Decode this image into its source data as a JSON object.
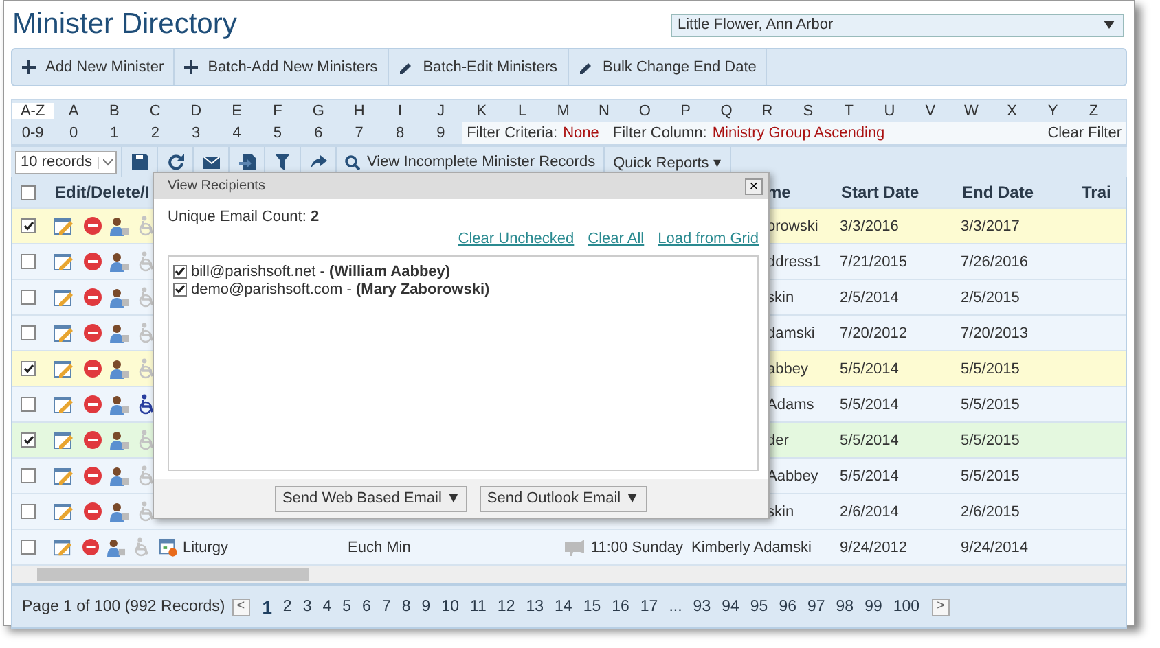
{
  "title": "Minister Directory",
  "parish": {
    "value": "Little Flower, Ann Arbor"
  },
  "toolbar": [
    {
      "label": "Add New Minister"
    },
    {
      "label": "Batch-Add New Ministers"
    },
    {
      "label": "Batch-Edit Ministers"
    },
    {
      "label": "Bulk Change End Date"
    }
  ],
  "letters": [
    {
      "label": "A-Z",
      "selected": true
    },
    {
      "label": "A",
      "selected": false
    },
    {
      "label": "B",
      "selected": false
    },
    {
      "label": "C",
      "selected": false
    },
    {
      "label": "D",
      "selected": false
    },
    {
      "label": "E",
      "selected": false
    },
    {
      "label": "F",
      "selected": false
    },
    {
      "label": "G",
      "selected": false
    },
    {
      "label": "H",
      "selected": false
    },
    {
      "label": "I",
      "selected": false
    },
    {
      "label": "J",
      "selected": false
    },
    {
      "label": "K",
      "selected": false
    },
    {
      "label": "L",
      "selected": false
    },
    {
      "label": "M",
      "selected": false
    },
    {
      "label": "N",
      "selected": false
    },
    {
      "label": "O",
      "selected": false
    },
    {
      "label": "P",
      "selected": false
    },
    {
      "label": "Q",
      "selected": false
    },
    {
      "label": "R",
      "selected": false
    },
    {
      "label": "S",
      "selected": false
    },
    {
      "label": "T",
      "selected": false
    },
    {
      "label": "U",
      "selected": false
    },
    {
      "label": "V",
      "selected": false
    },
    {
      "label": "W",
      "selected": false
    },
    {
      "label": "X",
      "selected": false
    },
    {
      "label": "Y",
      "selected": false
    },
    {
      "label": "Z",
      "selected": false
    }
  ],
  "digits": [
    {
      "label": "0-9",
      "selected": false
    },
    {
      "label": "0",
      "selected": false
    },
    {
      "label": "1",
      "selected": false
    },
    {
      "label": "2",
      "selected": false
    },
    {
      "label": "3",
      "selected": false
    },
    {
      "label": "4",
      "selected": false
    },
    {
      "label": "5",
      "selected": false
    },
    {
      "label": "6",
      "selected": false
    },
    {
      "label": "7",
      "selected": false
    },
    {
      "label": "8",
      "selected": false
    },
    {
      "label": "9",
      "selected": false
    }
  ],
  "filter": {
    "criteria_label": "Filter Criteria:",
    "criteria": "None",
    "column_label": "Filter Column:",
    "column": "Ministry Group Ascending",
    "clear": "Clear Filter"
  },
  "grid_toolbar": {
    "page_size": "10 records",
    "incomplete": "View Incomplete Minister Records",
    "reports": "Quick Reports ▾"
  },
  "select_all": {
    "checked": false
  },
  "columns": {
    "actions": "Edit/Delete/I",
    "name": "me",
    "start": "Start Date",
    "end": "End Date",
    "column_6": "Trai"
  },
  "rows": [
    {
      "kind": "partial",
      "checked": true,
      "color": "#fdfbd2",
      "accessible": false,
      "name": "orowski",
      "start": "3/3/2016",
      "end": "3/3/2017"
    },
    {
      "kind": "partial",
      "checked": false,
      "color": "#eef5fc",
      "accessible": false,
      "name": "ddress1",
      "start": "7/21/2015",
      "end": "7/26/2016"
    },
    {
      "kind": "partial",
      "checked": false,
      "color": "#eef5fc",
      "accessible": false,
      "name": "skin",
      "start": "2/5/2014",
      "end": "2/5/2015"
    },
    {
      "kind": "partial",
      "checked": false,
      "color": "#eef5fc",
      "accessible": false,
      "name": "damski",
      "start": "7/20/2012",
      "end": "7/20/2013"
    },
    {
      "kind": "partial",
      "checked": true,
      "color": "#fdfbd2",
      "accessible": false,
      "name": "abbey",
      "start": "5/5/2014",
      "end": "5/5/2015"
    },
    {
      "kind": "partial",
      "checked": false,
      "color": "#eef5fc",
      "accessible": true,
      "name": "Adams",
      "start": "5/5/2014",
      "end": "5/5/2015"
    },
    {
      "kind": "partial",
      "checked": true,
      "color": "#e4f8df",
      "accessible": false,
      "name": "der",
      "start": "5/5/2014",
      "end": "5/5/2015"
    },
    {
      "kind": "partial",
      "checked": false,
      "color": "#eef5fc",
      "accessible": false,
      "name": "Aabbey",
      "start": "5/5/2014",
      "end": "5/5/2015"
    },
    {
      "kind": "partial",
      "checked": false,
      "color": "#eef5fc",
      "accessible": false,
      "name": "skin",
      "start": "2/6/2014",
      "end": "2/6/2015"
    },
    {
      "kind": "full",
      "checked": false,
      "color": "#eef5fc",
      "accessible": false,
      "group": "Liturgy",
      "ministry": "Euch Min",
      "time": "11:00 Sunday",
      "name": "Kimberly Adamski",
      "start": "9/24/2012",
      "end": "9/24/2014"
    }
  ],
  "pager": {
    "summary": "Page 1 of 100 (992 Records)",
    "prev": "<",
    "next": ">",
    "pages": [
      {
        "label": "1",
        "selected": true
      },
      {
        "label": "2",
        "selected": false
      },
      {
        "label": "3",
        "selected": false
      },
      {
        "label": "4",
        "selected": false
      },
      {
        "label": "5",
        "selected": false
      },
      {
        "label": "6",
        "selected": false
      },
      {
        "label": "7",
        "selected": false
      },
      {
        "label": "8",
        "selected": false
      },
      {
        "label": "9",
        "selected": false
      },
      {
        "label": "10",
        "selected": false
      },
      {
        "label": "11",
        "selected": false
      },
      {
        "label": "12",
        "selected": false
      },
      {
        "label": "13",
        "selected": false
      },
      {
        "label": "14",
        "selected": false
      },
      {
        "label": "15",
        "selected": false
      },
      {
        "label": "16",
        "selected": false
      },
      {
        "label": "17",
        "selected": false
      },
      {
        "label": "...",
        "selected": false
      },
      {
        "label": "93",
        "selected": false
      },
      {
        "label": "94",
        "selected": false
      },
      {
        "label": "95",
        "selected": false
      },
      {
        "label": "96",
        "selected": false
      },
      {
        "label": "97",
        "selected": false
      },
      {
        "label": "98",
        "selected": false
      },
      {
        "label": "99",
        "selected": false
      },
      {
        "label": "100",
        "selected": false
      }
    ]
  },
  "dialog": {
    "title": "View Recipients",
    "close": "×",
    "count": "Unique Email Count: **2**",
    "links": [
      "Clear Unchecked",
      "Clear All",
      "Load from Grid"
    ],
    "recipients": [
      {
        "text": "bill@parishsoft.net - **(William Aabbey)**",
        "checked": true
      },
      {
        "text": "demo@parishsoft.com - **(Mary Zaborowski)**",
        "checked": true
      }
    ],
    "buttons": [
      "Send Web Based Email ▼",
      "Send Outlook Email ▼"
    ]
  }
}
